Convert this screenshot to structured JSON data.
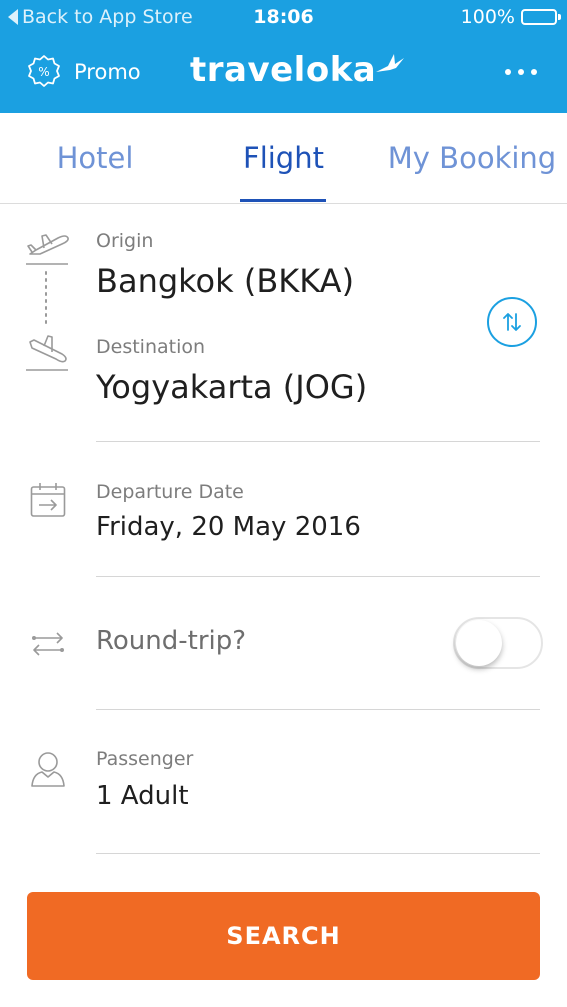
{
  "status_bar": {
    "back_label": "Back to App Store",
    "time": "18:06",
    "battery_percent": "100%",
    "battery_level": 1.0
  },
  "header": {
    "promo_label": "Promo",
    "promo_icon": "percent-badge-icon",
    "brand": "traveloka",
    "menu_icon": "more-horizontal-icon"
  },
  "tabs": [
    {
      "label": "Hotel",
      "active": false
    },
    {
      "label": "Flight",
      "active": true
    },
    {
      "label": "My Booking",
      "active": false
    }
  ],
  "form": {
    "origin": {
      "label": "Origin",
      "value": "Bangkok (BKKA)",
      "icon": "plane-takeoff-icon"
    },
    "destination": {
      "label": "Destination",
      "value": "Yogyakarta (JOG)",
      "icon": "plane-landing-icon"
    },
    "swap_icon": "swap-vertical-icon",
    "departure": {
      "label": "Departure Date",
      "value": "Friday, 20 May 2016",
      "icon": "calendar-icon"
    },
    "round_trip": {
      "label": "Round-trip?",
      "enabled": false,
      "icon": "round-trip-arrows-icon"
    },
    "passenger": {
      "label": "Passenger",
      "value": "1 Adult",
      "icon": "person-icon"
    }
  },
  "search_button": {
    "label": "SEARCH"
  },
  "colors": {
    "header_bg": "#1ba0e1",
    "tab_active": "#1e52b7",
    "tab_inactive": "#6f93d6",
    "search_button": "#f06a24"
  }
}
